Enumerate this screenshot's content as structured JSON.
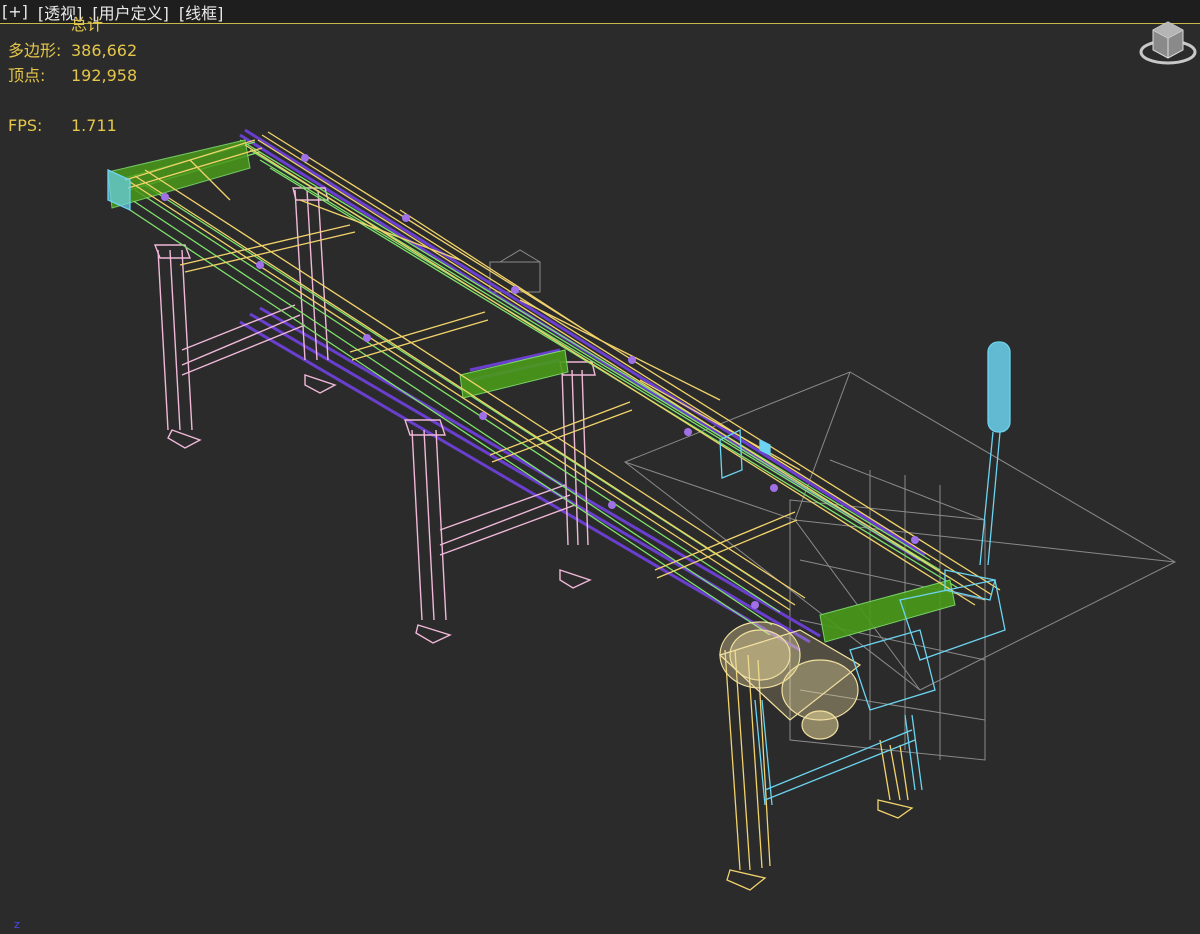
{
  "viewport": {
    "labels": [
      "[+]",
      "[透视]",
      "[用户定义]",
      "[线框]"
    ]
  },
  "stats": {
    "total_label": "总计",
    "polygons_label": "多边形:",
    "polygons_value": "386,662",
    "vertices_label": "顶点:",
    "vertices_value": "192,958",
    "fps_label": "FPS:",
    "fps_value": "1.711"
  },
  "axis": {
    "z_label": "z"
  },
  "colors": {
    "background": "#2b2b2b",
    "header": "#1e1e1e",
    "stats_text": "#e4c64a",
    "frame_yellow": "#f2d36b",
    "frame_green": "#7fe36b",
    "legs_pink": "#f0b8d8",
    "cyan_parts": "#6cd4f0",
    "purple_parts": "#6a3fd0",
    "grey_guard": "#9a9a9a",
    "dark_green": "#4a9a1a"
  },
  "icons": {
    "viewcube": "viewcube-icon"
  }
}
